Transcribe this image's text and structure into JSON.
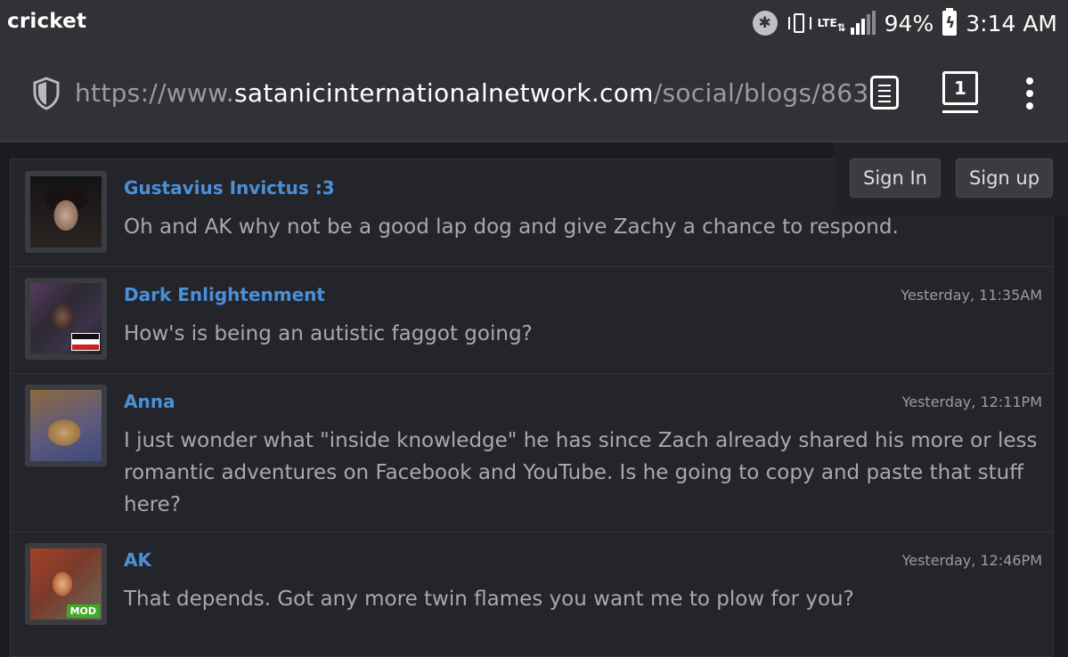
{
  "status_bar": {
    "carrier": "cricket",
    "network": "LTE",
    "battery": "94%",
    "time": "3:14 AM",
    "icons": [
      "bluetooth-icon",
      "vibrate-icon",
      "lte-icon",
      "signal-icon",
      "battery-charging-icon"
    ]
  },
  "browser": {
    "url_prefix": "https://www.",
    "url_host": "satanicinternationalnetwork.com",
    "url_path": "/social/blogs/863",
    "tab_count": "1",
    "icons": [
      "shield-icon",
      "reader-mode-icon",
      "tabs-icon",
      "overflow-menu-icon"
    ]
  },
  "auth": {
    "sign_in": "Sign In",
    "sign_up": "Sign up"
  },
  "comments": [
    {
      "author": "Gustavius Invictus :3",
      "time": "",
      "text": "Oh and AK why not be a good lap dog and give Zachy a chance to respond."
    },
    {
      "author": "Dark Enlightenment",
      "time": "Yesterday, 11:35AM",
      "text": "How's is being an autistic faggot going?"
    },
    {
      "author": "Anna",
      "time": "Yesterday, 12:11PM",
      "text": "I just wonder what \"inside knowledge\" he has since Zach already shared his more or less romantic adventures on Facebook and YouTube. Is he going to copy and paste that stuff here?"
    },
    {
      "author": "AK",
      "time": "Yesterday, 12:46PM",
      "text": "That depends. Got any more twin flames you want me to plow for you?",
      "badge": "MOD"
    }
  ],
  "colors": {
    "chrome": "#323236",
    "page_bg": "#1b1c20",
    "panel_bg": "#24252a",
    "author_link": "#4a90d9",
    "body_text": "#a9a9ad",
    "mod_badge": "#3eab27"
  }
}
